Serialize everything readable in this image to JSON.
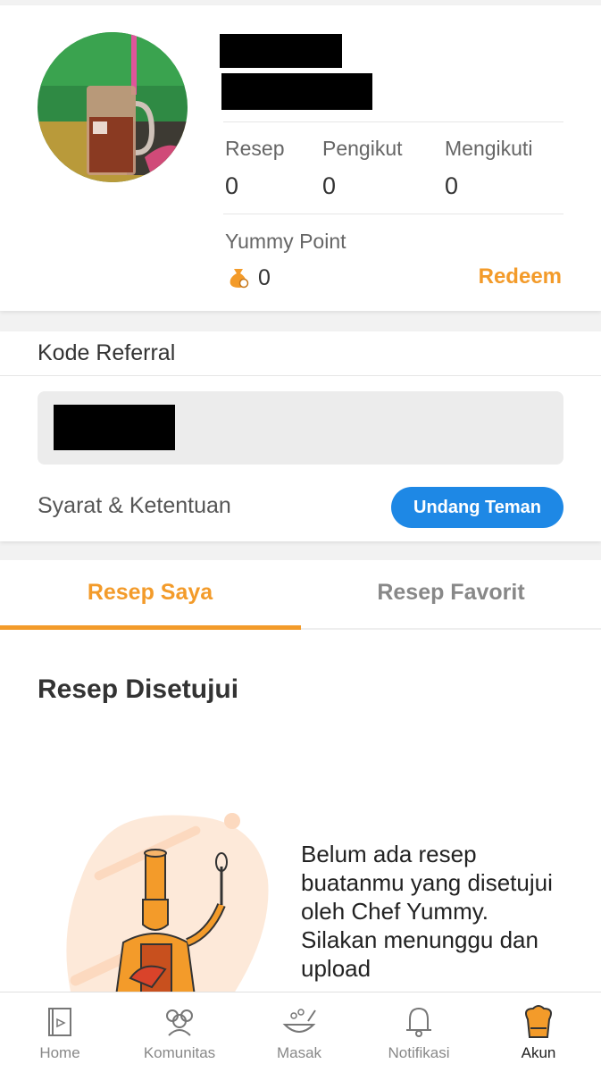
{
  "profile": {
    "stats": [
      {
        "label": "Resep",
        "value": "0"
      },
      {
        "label": "Pengikut",
        "value": "0"
      },
      {
        "label": "Mengikuti",
        "value": "0"
      }
    ],
    "points_label": "Yummy Point",
    "points_value": "0",
    "redeem_label": "Redeem"
  },
  "referral": {
    "title": "Kode Referral",
    "terms_label": "Syarat & Ketentuan",
    "invite_button": "Undang Teman"
  },
  "tabs": [
    {
      "label": "Resep Saya",
      "active": true
    },
    {
      "label": "Resep Favorit",
      "active": false
    }
  ],
  "content": {
    "section_title": "Resep Disetujui",
    "empty_message": "Belum ada resep buatanmu yang disetujui oleh Chef Yummy. Silakan menunggu dan upload"
  },
  "bottom_nav": [
    {
      "label": "Home",
      "icon": "home-icon"
    },
    {
      "label": "Komunitas",
      "icon": "community-icon"
    },
    {
      "label": "Masak",
      "icon": "cooking-icon"
    },
    {
      "label": "Notifikasi",
      "icon": "bell-icon"
    },
    {
      "label": "Akun",
      "icon": "chef-hat-icon",
      "active": true
    }
  ],
  "colors": {
    "accent": "#f39b2a",
    "button_blue": "#1e88e5"
  }
}
